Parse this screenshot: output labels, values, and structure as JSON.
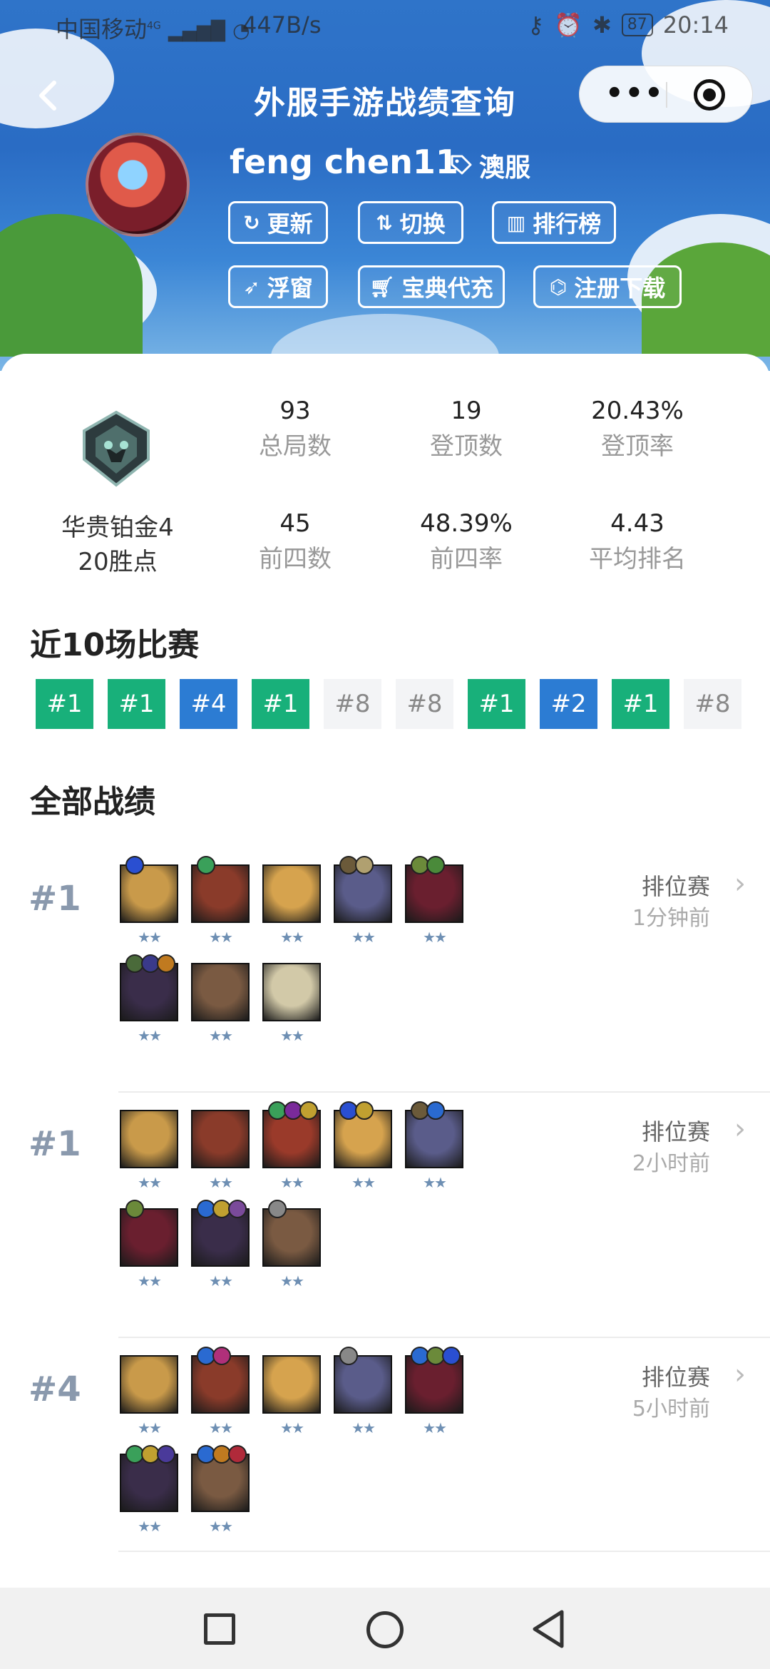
{
  "status_bar": {
    "carrier": "中国移动",
    "network": "4G",
    "speed": "447B/s",
    "battery": "87",
    "time": "20:14"
  },
  "nav": {
    "title": "外服手游战绩查询",
    "more_icon": "more-dots-icon",
    "close_icon": "target-close-icon"
  },
  "profile": {
    "username": "feng chen11",
    "server": "澳服",
    "buttons": [
      {
        "label": "更新",
        "icon": "refresh-icon"
      },
      {
        "label": "切换",
        "icon": "switch-icon"
      },
      {
        "label": "排行榜",
        "icon": "chart-icon"
      },
      {
        "label": "浮窗",
        "icon": "send-icon"
      },
      {
        "label": "宝典代充",
        "icon": "cart-icon"
      },
      {
        "label": "注册下载",
        "icon": "gamepad-icon"
      }
    ]
  },
  "rank": {
    "tier": "华贵铂金4",
    "points": "20胜点"
  },
  "stats": [
    {
      "value": "93",
      "label": "总局数"
    },
    {
      "value": "19",
      "label": "登顶数"
    },
    {
      "value": "20.43%",
      "label": "登顶率"
    },
    {
      "value": "45",
      "label": "前四数"
    },
    {
      "value": "48.39%",
      "label": "前四率"
    },
    {
      "value": "4.43",
      "label": "平均排名"
    }
  ],
  "recent": {
    "title": "近10场比赛",
    "results": [
      {
        "label": "#1",
        "kind": "green"
      },
      {
        "label": "#1",
        "kind": "green"
      },
      {
        "label": "#4",
        "kind": "blue"
      },
      {
        "label": "#1",
        "kind": "green"
      },
      {
        "label": "#8",
        "kind": "gray"
      },
      {
        "label": "#8",
        "kind": "gray"
      },
      {
        "label": "#1",
        "kind": "green"
      },
      {
        "label": "#2",
        "kind": "blue"
      },
      {
        "label": "#1",
        "kind": "green"
      },
      {
        "label": "#8",
        "kind": "gray"
      }
    ]
  },
  "history": {
    "title": "全部战绩",
    "matches": [
      {
        "place": "#1",
        "type": "排位赛",
        "time": "1分钟前",
        "stars": "★★",
        "units": [
          {
            "color": "#c99a4a",
            "items": [
              "#2a4fd1"
            ]
          },
          {
            "color": "#8a3b2a",
            "items": [
              "#3aa05a"
            ]
          },
          {
            "color": "#d6a34e",
            "items": []
          },
          {
            "color": "#5a5c8a",
            "items": [
              "#6b5a3a",
              "#b0a070"
            ]
          },
          {
            "color": "#6a1f2f",
            "items": [
              "#6b8a3a",
              "#4a8a3a"
            ]
          },
          {
            "color": "#3a2d4a",
            "items": [
              "#4a6a3a",
              "#3a3a8a",
              "#c07a20"
            ]
          },
          {
            "color": "#7a5a42",
            "items": []
          },
          {
            "color": "#d2c9a8",
            "items": []
          }
        ]
      },
      {
        "place": "#1",
        "type": "排位赛",
        "time": "2小时前",
        "stars": "★★",
        "units": [
          {
            "color": "#c99a4a",
            "items": []
          },
          {
            "color": "#8a3b2a",
            "items": []
          },
          {
            "color": "#9a3a2a",
            "items": [
              "#3aa05a",
              "#7a2a9a",
              "#c0a030"
            ]
          },
          {
            "color": "#d6a34e",
            "items": [
              "#2a4fd1",
              "#c0a030"
            ]
          },
          {
            "color": "#5a5c8a",
            "items": [
              "#6b5a3a",
              "#2a6ad1"
            ]
          },
          {
            "color": "#6a1f2f",
            "items": [
              "#6b8a3a"
            ]
          },
          {
            "color": "#3a2d4a",
            "items": [
              "#2a6ad1",
              "#c0a030",
              "#7a4a9a"
            ]
          },
          {
            "color": "#7a5a42",
            "items": [
              "#888888"
            ]
          }
        ]
      },
      {
        "place": "#4",
        "type": "排位赛",
        "time": "5小时前",
        "stars": "★★",
        "units": [
          {
            "color": "#c99a4a",
            "items": []
          },
          {
            "color": "#8a3b2a",
            "items": [
              "#2a6ad1",
              "#b0307a"
            ]
          },
          {
            "color": "#d6a34e",
            "items": []
          },
          {
            "color": "#5a5c8a",
            "items": [
              "#888888"
            ]
          },
          {
            "color": "#6a1f2f",
            "items": [
              "#2a6ad1",
              "#6b8a3a",
              "#2a4fd1"
            ]
          },
          {
            "color": "#3a2d4a",
            "items": [
              "#3aa05a",
              "#c0a030",
              "#4a3a9a"
            ]
          },
          {
            "color": "#7a5a42",
            "items": [
              "#2a6ad1",
              "#c07a20",
              "#b02a3a"
            ]
          }
        ]
      }
    ]
  },
  "system_nav": {
    "recent_icon": "square-recents-icon",
    "home_icon": "circle-home-icon",
    "back_icon": "triangle-back-icon"
  }
}
